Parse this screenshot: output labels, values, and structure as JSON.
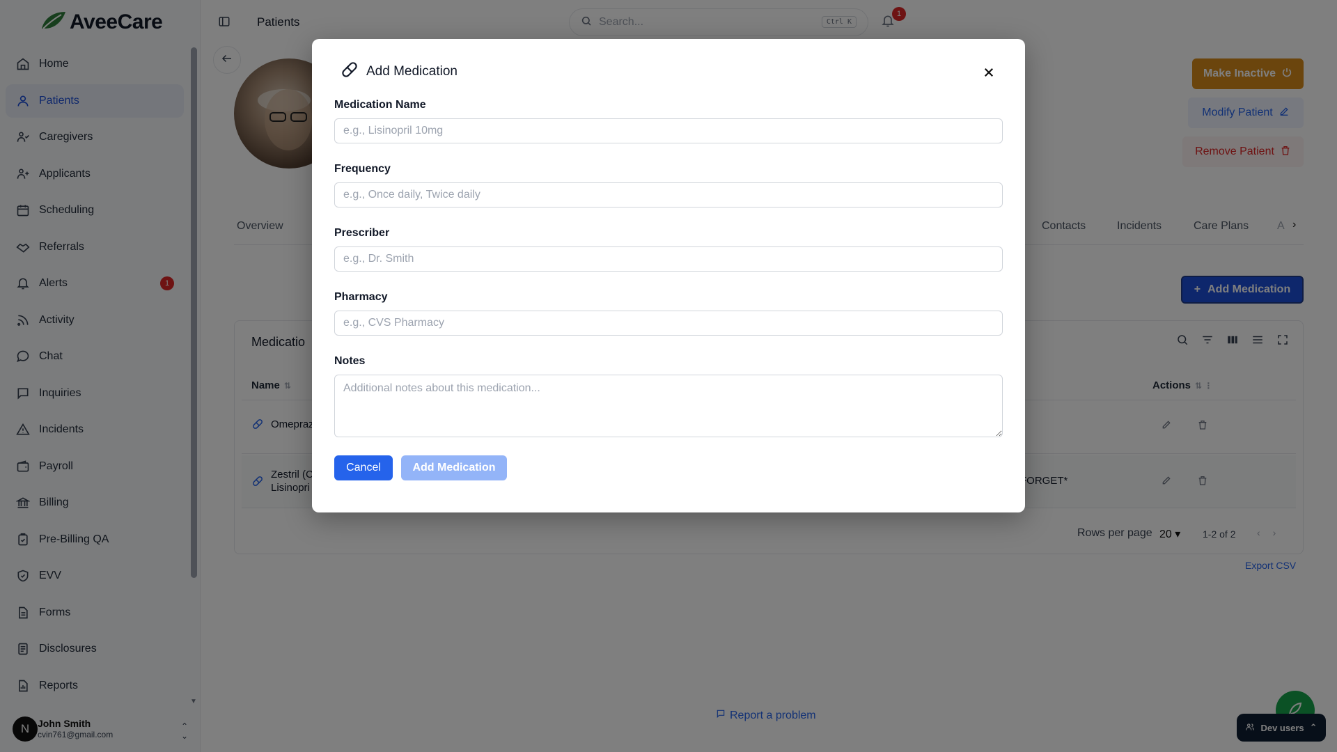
{
  "app": {
    "name": "AveeCare"
  },
  "sidebar": {
    "items": [
      {
        "label": "Home",
        "icon": "home-icon"
      },
      {
        "label": "Patients",
        "icon": "user-icon",
        "active": true
      },
      {
        "label": "Caregivers",
        "icon": "caregivers-icon"
      },
      {
        "label": "Applicants",
        "icon": "user-plus-icon"
      },
      {
        "label": "Scheduling",
        "icon": "calendar-icon"
      },
      {
        "label": "Referrals",
        "icon": "handshake-icon"
      },
      {
        "label": "Alerts",
        "icon": "bell-icon",
        "badge": "1"
      },
      {
        "label": "Activity",
        "icon": "rss-icon"
      },
      {
        "label": "Chat",
        "icon": "chat-icon"
      },
      {
        "label": "Inquiries",
        "icon": "message-square-icon"
      },
      {
        "label": "Incidents",
        "icon": "alert-triangle-icon"
      },
      {
        "label": "Payroll",
        "icon": "wallet-icon"
      },
      {
        "label": "Billing",
        "icon": "bank-icon"
      },
      {
        "label": "Pre-Billing QA",
        "icon": "clipboard-check-icon"
      },
      {
        "label": "EVV",
        "icon": "shield-check-icon"
      },
      {
        "label": "Forms",
        "icon": "file-text-icon"
      },
      {
        "label": "Disclosures",
        "icon": "file-list-icon"
      },
      {
        "label": "Reports",
        "icon": "report-icon"
      }
    ],
    "user": {
      "initial": "N",
      "name": "John Smith",
      "email": "cvin761@gmail.com"
    }
  },
  "header": {
    "title": "Patients",
    "search_placeholder": "Search...",
    "shortcut": "Ctrl K",
    "notification_count": "1"
  },
  "patient_actions": {
    "make_inactive": "Make Inactive",
    "modify": "Modify Patient",
    "remove": "Remove Patient"
  },
  "tabs": [
    {
      "label": "Overview"
    },
    {
      "label": "Contacts"
    },
    {
      "label": "Incidents"
    },
    {
      "label": "Care Plans"
    }
  ],
  "tabs_overflow": "A",
  "medications": {
    "add_button": "Add Medication",
    "title": "Medicatio",
    "columns": {
      "name": "Name",
      "actions": "Actions"
    },
    "rows": [
      {
        "name_line1": "Omepraz",
        "name_line2": "",
        "extra": ""
      },
      {
        "name_line1": "Zestril (C",
        "name_line2": "Lisinopri",
        "extra": "FORGET*"
      }
    ],
    "rows_per_page_label": "Rows per page",
    "rows_per_page": "20",
    "range": "1-2 of 2",
    "export": "Export CSV"
  },
  "footer": {
    "report": "Report a problem",
    "dev_users": "Dev users"
  },
  "modal": {
    "title": "Add Medication",
    "fields": {
      "name": {
        "label": "Medication Name",
        "placeholder": "e.g., Lisinopril 10mg",
        "value": ""
      },
      "frequency": {
        "label": "Frequency",
        "placeholder": "e.g., Once daily, Twice daily",
        "value": ""
      },
      "prescriber": {
        "label": "Prescriber",
        "placeholder": "e.g., Dr. Smith",
        "value": ""
      },
      "pharmacy": {
        "label": "Pharmacy",
        "placeholder": "e.g., CVS Pharmacy",
        "value": ""
      },
      "notes": {
        "label": "Notes",
        "placeholder": "Additional notes about this medication...",
        "value": ""
      }
    },
    "cancel": "Cancel",
    "submit": "Add Medication"
  },
  "colors": {
    "primary": "#2563eb",
    "warning": "#d68a1a",
    "danger": "#dc2626",
    "success": "#16a34a"
  }
}
